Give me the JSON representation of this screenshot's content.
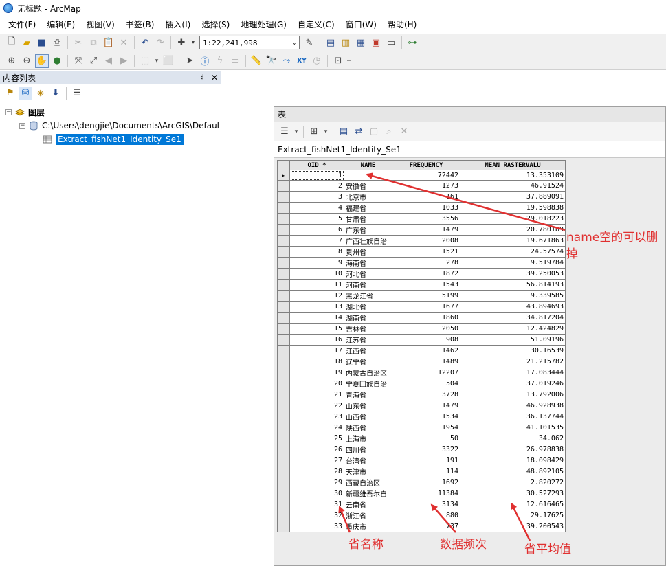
{
  "window": {
    "title": "无标题 - ArcMap"
  },
  "menu": [
    "文件(F)",
    "编辑(E)",
    "视图(V)",
    "书签(B)",
    "插入(I)",
    "选择(S)",
    "地理处理(G)",
    "自定义(C)",
    "窗口(W)",
    "帮助(H)"
  ],
  "toolbar": {
    "scale": "1:22,241,998"
  },
  "toc": {
    "title": "内容列表",
    "pin": "♯",
    "close": "✕",
    "layers_label": "图层",
    "folder_path": "C:\\Users\\dengjie\\Documents\\ArcGIS\\Defaul",
    "selected_table": "Extract_fishNet1_Identity_Se1"
  },
  "table_window": {
    "title": "表",
    "tab_name": "Extract_fishNet1_Identity_Se1",
    "columns": [
      "OID *",
      "NAME",
      "FREQUENCY",
      "MEAN_RASTERVALU"
    ],
    "rows": [
      [
        "1",
        "",
        "72442",
        "13.353109"
      ],
      [
        "2",
        "安徽省",
        "1273",
        "46.91524"
      ],
      [
        "3",
        "北京市",
        "161",
        "37.889091"
      ],
      [
        "4",
        "福建省",
        "1033",
        "19.598838"
      ],
      [
        "5",
        "甘肃省",
        "3556",
        "29.018223"
      ],
      [
        "6",
        "广东省",
        "1479",
        "20.780189"
      ],
      [
        "7",
        "广西壮族自治",
        "2008",
        "19.671863"
      ],
      [
        "8",
        "贵州省",
        "1521",
        "24.57574"
      ],
      [
        "9",
        "海南省",
        "278",
        "9.519784"
      ],
      [
        "10",
        "河北省",
        "1872",
        "39.250053"
      ],
      [
        "11",
        "河南省",
        "1543",
        "56.814193"
      ],
      [
        "12",
        "黑龙江省",
        "5199",
        "9.339585"
      ],
      [
        "13",
        "湖北省",
        "1677",
        "43.894693"
      ],
      [
        "14",
        "湖南省",
        "1860",
        "34.817204"
      ],
      [
        "15",
        "吉林省",
        "2050",
        "12.424829"
      ],
      [
        "16",
        "江苏省",
        "908",
        "51.09196"
      ],
      [
        "17",
        "江西省",
        "1462",
        "30.16539"
      ],
      [
        "18",
        "辽宁省",
        "1489",
        "21.215782"
      ],
      [
        "19",
        "内蒙古自治区",
        "12207",
        "17.083444"
      ],
      [
        "20",
        "宁夏回族自治",
        "504",
        "37.019246"
      ],
      [
        "21",
        "青海省",
        "3728",
        "13.792006"
      ],
      [
        "22",
        "山东省",
        "1479",
        "46.928938"
      ],
      [
        "23",
        "山西省",
        "1534",
        "36.137744"
      ],
      [
        "24",
        "陕西省",
        "1954",
        "41.101535"
      ],
      [
        "25",
        "上海市",
        "50",
        "34.062"
      ],
      [
        "26",
        "四川省",
        "3322",
        "26.978838"
      ],
      [
        "27",
        "台湾省",
        "191",
        "18.098429"
      ],
      [
        "28",
        "天津市",
        "114",
        "48.892105"
      ],
      [
        "29",
        "西藏自治区",
        "1692",
        "2.820272"
      ],
      [
        "30",
        "新疆维吾尔自",
        "11384",
        "30.527293"
      ],
      [
        "31",
        "云南省",
        "3134",
        "12.616465"
      ],
      [
        "32",
        "浙江省",
        "880",
        "29.17625"
      ],
      [
        "33",
        "重庆市",
        "737",
        "39.200543"
      ]
    ]
  },
  "annotations": {
    "name_note": "name空的可以删掉",
    "province_name": "省名称",
    "frequency": "数据频次",
    "province_mean": "省平均值"
  },
  "colors": {
    "annotation": "#e03030",
    "selection": "#0078d7"
  }
}
